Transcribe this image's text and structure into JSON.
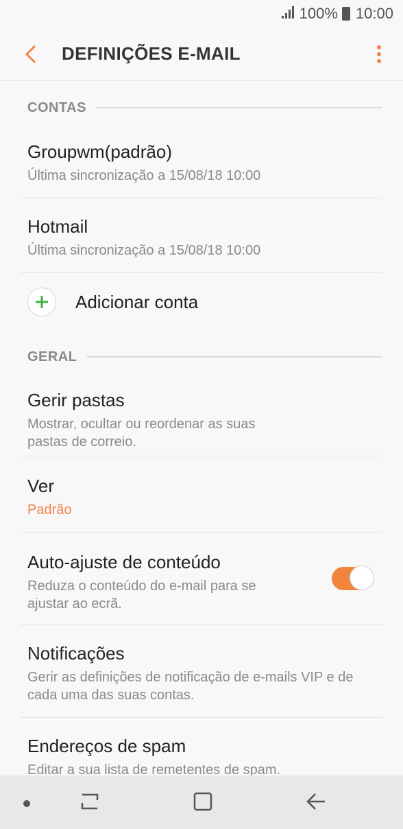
{
  "status": {
    "battery": "100%",
    "time": "10:00"
  },
  "header": {
    "title": "DEFINIÇÕES E-MAIL"
  },
  "sections": {
    "accounts": {
      "label": "CONTAS",
      "items": [
        {
          "title": "Groupwm(padrão)",
          "subtitle": "Última sincronização a 15/08/18  10:00"
        },
        {
          "title": "Hotmail",
          "subtitle": "Última sincronização a 15/08/18  10:00"
        }
      ],
      "add_label": "Adicionar conta"
    },
    "general": {
      "label": "GERAL",
      "items": [
        {
          "title": "Gerir pastas",
          "subtitle": "Mostrar, ocultar ou reordenar as suas pastas de correio."
        },
        {
          "title": "Ver",
          "subtitle": "Padrão"
        },
        {
          "title": "Auto-ajuste de conteúdo",
          "subtitle": "Reduza o conteúdo do e-mail para se ajustar ao ecrã.",
          "toggle_on": true
        },
        {
          "title": "Notificações",
          "subtitle": "Gerir as definições de notificação de e-mails VIP e de cada uma das suas contas."
        },
        {
          "title": "Endereços de spam",
          "subtitle": "Editar a sua lista de remetentes de spam."
        }
      ]
    }
  },
  "colors": {
    "accent": "#f0844a",
    "background": "#f8f8f8"
  },
  "icons": [
    "signal-icon",
    "battery-icon",
    "back-arrow-icon",
    "more-vert-icon",
    "plus-icon",
    "recent-apps-icon",
    "home-icon",
    "nav-back-icon"
  ]
}
